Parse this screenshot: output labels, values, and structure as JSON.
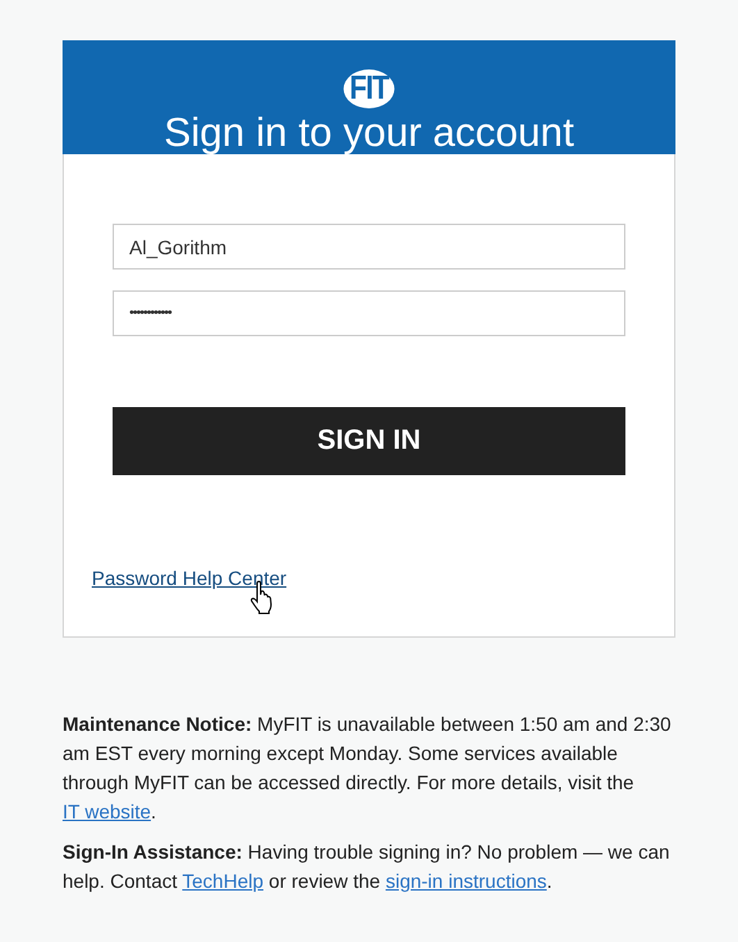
{
  "header": {
    "logo": "FIT",
    "title": "Sign in to your account"
  },
  "username": {
    "value": "Al_Gorithm"
  },
  "password": {
    "value": "••••••••••••"
  },
  "sign_in_button": "SIGN IN",
  "help_link": "Password Help Center",
  "notices": [
    {
      "segments": [
        {
          "kind": "text",
          "text": "**Maintenance Notice:** MyFIT is unavailable between 1:50 am and 2:30 am EST every morning except Monday. Some services available through MyFIT can be accessed directly. For more details, visit the "
        },
        {
          "kind": "link",
          "text": "IT website"
        },
        {
          "kind": "text",
          "text": "."
        }
      ]
    },
    {
      "segments": [
        {
          "kind": "text",
          "text": "**Sign-In Assistance:** Having trouble signing in? No problem — we can help. Contact "
        },
        {
          "kind": "link",
          "text": "TechHelp"
        },
        {
          "kind": "text",
          "text": " or review the "
        },
        {
          "kind": "link",
          "text": "sign-in instructions"
        },
        {
          "kind": "text",
          "text": "."
        }
      ]
    }
  ]
}
